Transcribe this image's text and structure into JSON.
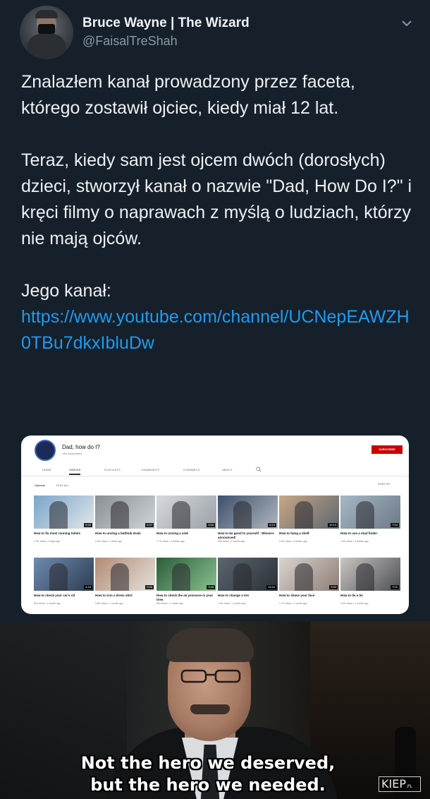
{
  "tweet": {
    "author": {
      "display_name": "Bruce Wayne | The Wizard",
      "handle": "@FaisalTreShah"
    },
    "paragraphs": [
      "Znalazłem kanał prowadzony przez faceta, którego zostawił ojciec, kiedy miał 12 lat.",
      "Teraz, kiedy sam jest ojcem dwóch (dorosłych) dzieci, stworzył kanał o nazwie \"Dad, How Do I?\" i kręci filmy o naprawach z myślą o ludziach, którzy nie mają ojców.",
      "Jego kanał:"
    ],
    "link": "https://www.youtube.com/channel/UCNepEAWZH0TBu7dkxIbluDw",
    "colors": {
      "background": "#15202b",
      "link": "#1d9bf0"
    }
  },
  "youtube": {
    "channel_name": "Dad, how do I?",
    "subscribers": "14K subscribers",
    "subscribe_label": "SUBSCRIBE",
    "tabs": [
      "HOME",
      "VIDEOS",
      "PLAYLISTS",
      "COMMUNITY",
      "CHANNELS",
      "ABOUT"
    ],
    "active_tab": "VIDEOS",
    "uploads_label": "Uploads",
    "play_all_label": "PLAY ALL",
    "sort_label": "SORT BY",
    "videos": [
      {
        "title": "How to fix most running toilets",
        "meta": "2.3K views • 4 days ago",
        "duration": "8:32",
        "palette": [
          "#7aa4c9",
          "#e0e6ea"
        ]
      },
      {
        "title": "How to unclog a bathtub drain",
        "meta": "2.9K views • 1 week ago",
        "duration": "5:47",
        "palette": [
          "#8a8f94",
          "#cfd4d8"
        ]
      },
      {
        "title": "How to unclog a sink",
        "meta": "1.7K views • 2 weeks ago",
        "duration": "9:56",
        "palette": [
          "#d6d9dc",
          "#9aa1a7"
        ]
      },
      {
        "title": "How to be good to yourself - Winners announced!",
        "meta": "993 views • 2 weeks ago",
        "duration": "6:13",
        "palette": [
          "#3e4f6b",
          "#b0b7bf"
        ]
      },
      {
        "title": "How to hang a shelf",
        "meta": "2.9K views • 3 weeks ago",
        "duration": "10:13",
        "palette": [
          "#c7a887",
          "#5d6770"
        ]
      },
      {
        "title": "How to use a stud finder",
        "meta": "1.9K views • 4 weeks ago",
        "duration": "7:04",
        "palette": [
          "#a7b7c6",
          "#6c7a86"
        ]
      },
      {
        "title": "How to check your car's oil",
        "meta": "8x4 views • 1 month ago",
        "duration": "4:15",
        "palette": [
          "#6f8bb0",
          "#2d3c52"
        ]
      },
      {
        "title": "How to iron a dress shirt",
        "meta": "3.8K views • 1 month ago",
        "duration": "5:06",
        "palette": [
          "#b28a74",
          "#e5e1db"
        ]
      },
      {
        "title": "How to check the air pressure in your tires",
        "meta": "854 views • 1 month ago",
        "duration": "3:38",
        "palette": [
          "#2c5d3a",
          "#88c18f"
        ]
      },
      {
        "title": "How to change a tire",
        "meta": "1.5K views • 1 month ago",
        "duration": "13:24",
        "palette": [
          "#5c6670",
          "#2a3037"
        ]
      },
      {
        "title": "How to shave your face",
        "meta": "1.7K views • 1 month ago",
        "duration": "9:52",
        "palette": [
          "#d9d4d0",
          "#8e7f76"
        ]
      },
      {
        "title": "How to tie a tie",
        "meta": "3.3K views • 1 month ago",
        "duration": "7:01",
        "palette": [
          "#c9c6c2",
          "#4d4f55"
        ]
      }
    ]
  },
  "meme": {
    "caption_line1": "Not the hero we deserved,",
    "caption_line2": "but the hero we needed.",
    "watermark": "KIEP",
    "watermark_suffix": ".PL"
  }
}
